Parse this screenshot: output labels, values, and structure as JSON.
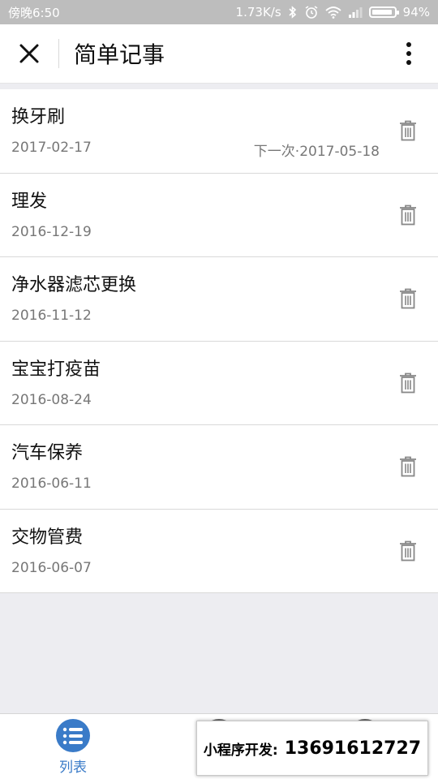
{
  "status_bar": {
    "time": "傍晚6:50",
    "speed": "1.73K/s",
    "battery": "94%"
  },
  "navbar": {
    "title": "简单记事",
    "close_icon": "close-icon",
    "more_icon": "more-vertical-icon"
  },
  "items": [
    {
      "title": "换牙刷",
      "date": "2017-02-17",
      "next": "下一次·2017-05-18"
    },
    {
      "title": "理发",
      "date": "2016-12-19",
      "next": ""
    },
    {
      "title": "净水器滤芯更换",
      "date": "2016-11-12",
      "next": ""
    },
    {
      "title": "宝宝打疫苗",
      "date": "2016-08-24",
      "next": ""
    },
    {
      "title": "汽车保养",
      "date": "2016-06-11",
      "next": ""
    },
    {
      "title": "交物管费",
      "date": "2016-06-07",
      "next": ""
    }
  ],
  "tabbar": {
    "list_label": "列表",
    "accent": "#3a7bc8"
  },
  "promo": {
    "label": "小程序开发:",
    "phone": "13691612727"
  }
}
